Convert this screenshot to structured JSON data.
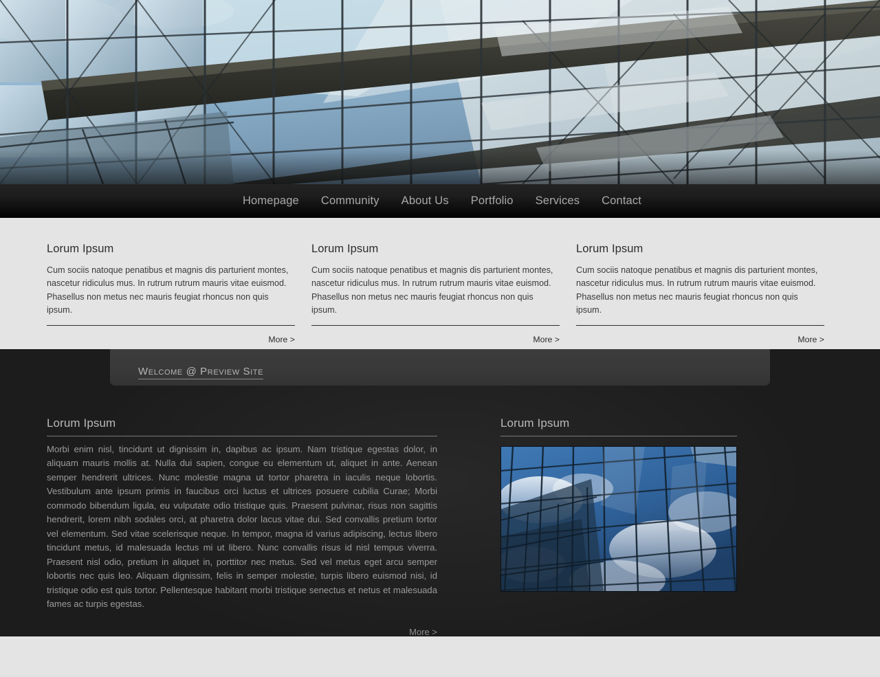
{
  "nav": {
    "items": [
      {
        "label": "Homepage"
      },
      {
        "label": "Community"
      },
      {
        "label": "About Us"
      },
      {
        "label": "Portfolio"
      },
      {
        "label": "Services"
      },
      {
        "label": "Contact"
      }
    ]
  },
  "hero": {
    "image_alt": "glass-and-steel atrium facade with diagonal bracing"
  },
  "features": {
    "more_label": "More >",
    "columns": [
      {
        "title": "Lorum Ipsum",
        "body": "Cum sociis natoque penatibus et magnis dis parturient montes, nascetur ridiculus mus. In rutrum rutrum mauris vitae euismod. Phasellus non metus nec mauris feugiat rhoncus non quis ipsum."
      },
      {
        "title": "Lorum Ipsum",
        "body": "Cum sociis natoque penatibus et magnis dis parturient montes, nascetur ridiculus mus. In rutrum rutrum mauris vitae euismod. Phasellus non metus nec mauris feugiat rhoncus non quis ipsum."
      },
      {
        "title": "Lorum Ipsum",
        "body": "Cum sociis natoque penatibus et magnis dis parturient montes, nascetur ridiculus mus. In rutrum rutrum mauris vitae euismod. Phasellus non metus nec mauris feugiat rhoncus non quis ipsum."
      }
    ]
  },
  "welcome": {
    "text": "Welcome @ Preview Site"
  },
  "article": {
    "title": "Lorum Ipsum",
    "body": "Morbi enim nisl, tincidunt ut dignissim in, dapibus ac ipsum. Nam tristique egestas dolor, in aliquam mauris mollis at. Nulla dui sapien, congue eu elementum ut, aliquet in ante. Aenean semper hendrerit ultrices. Nunc molestie magna ut tortor pharetra in iaculis neque lobortis. Vestibulum ante ipsum primis in faucibus orci luctus et ultrices posuere cubilia Curae; Morbi commodo bibendum ligula, eu vulputate odio tristique quis. Praesent pulvinar, risus non sagittis hendrerit, lorem nibh sodales orci, at pharetra dolor lacus vitae dui. Sed convallis pretium tortor vel elementum. Sed vitae scelerisque neque. In tempor, magna id varius adipiscing, lectus libero tincidunt metus, id malesuada lectus mi ut libero. Nunc convallis risus id nisl tempus viverra. Praesent nisl odio, pretium in aliquet in, porttitor nec metus. Sed vel metus eget arcu semper lobortis nec quis leo. Aliquam dignissim, felis in semper molestie, turpis libero euismod nisi, id tristique odio est quis tortor. Pellentesque habitant morbi tristique senectus et netus et malesuada fames ac turpis egestas.",
    "more_label": "More >"
  },
  "aside": {
    "title": "Lorum Ipsum",
    "image_alt": "blue glass office tower reflecting sky and clouds"
  },
  "colors": {
    "page_background": "#e4e4e4",
    "nav_background": "#0a0a0a",
    "nav_text": "#a9a9a9",
    "dark_section": "#1c1c1c",
    "welcome_panel": "#393939",
    "heading_dark": "#2d2d2d",
    "heading_light": "#b9b9b9",
    "body_light": "#9b9b9b"
  }
}
